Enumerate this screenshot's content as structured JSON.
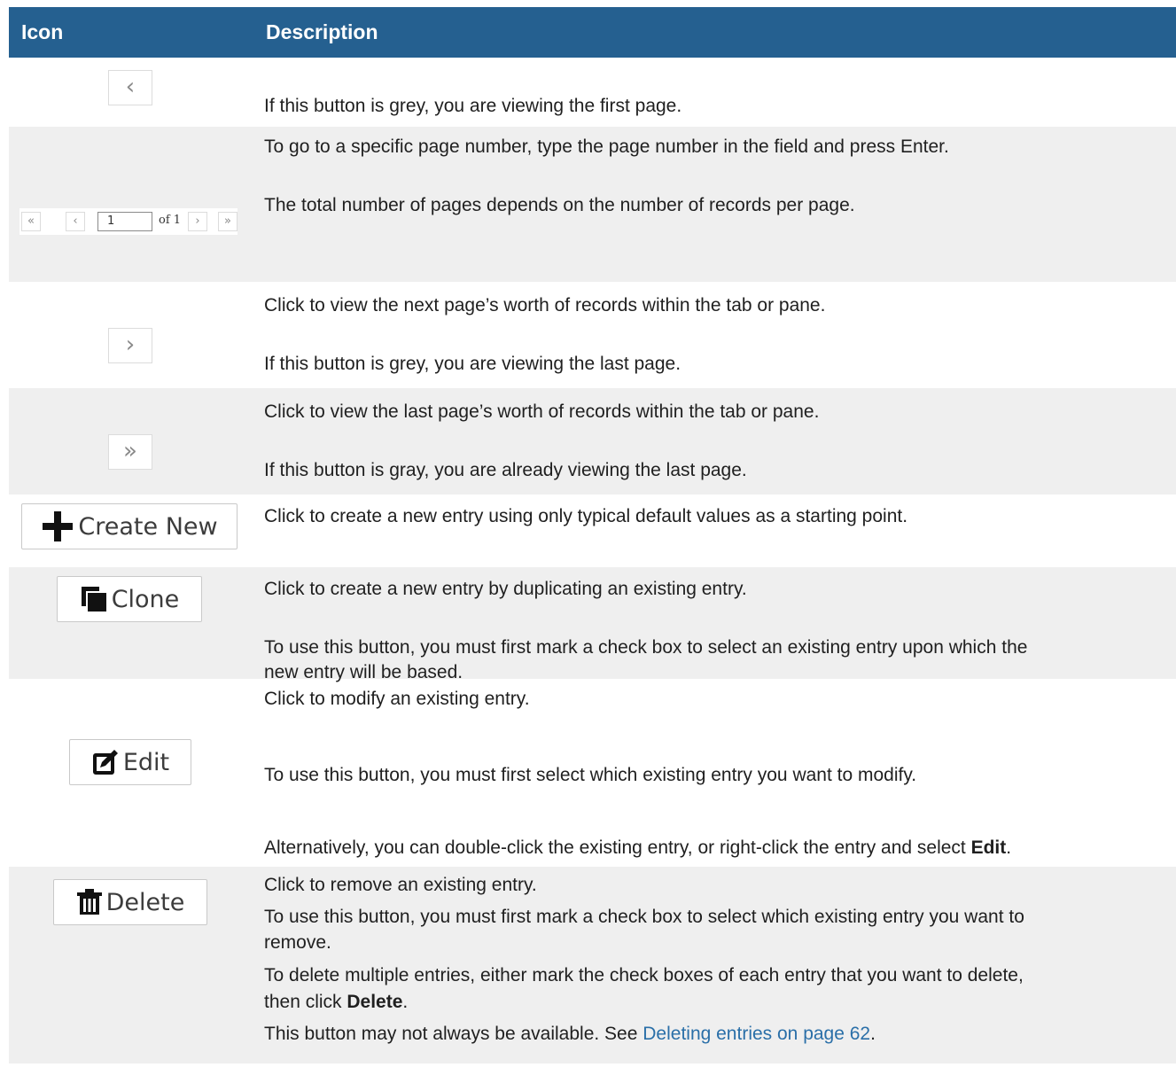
{
  "header": {
    "col_icon": "Icon",
    "col_description": "Description"
  },
  "pager": {
    "page_value": "1",
    "of_label": "of 1",
    "first": "«",
    "prev": "‹",
    "next": "›",
    "last": "»"
  },
  "buttons": {
    "prev_glyph": "‹",
    "next_glyph": "›",
    "last_glyph": "»",
    "create_new": "Create New",
    "clone": "Clone",
    "edit": "Edit",
    "delete": "Delete"
  },
  "rows": [
    {
      "p": [
        "If this button is grey, you are viewing the first page."
      ]
    },
    {
      "p": [
        "To go to a specific page number, type the page number in the field and press Enter.",
        "The total number of pages depends on the number of records per page."
      ]
    },
    {
      "p": [
        "Click to view the next page’s worth of records within the tab or pane.",
        "If this button is grey, you are viewing the last page."
      ]
    },
    {
      "p": [
        "Click to view the last page’s worth of records within the tab or pane.",
        "If this button is gray, you are already viewing the last page."
      ]
    },
    {
      "p": [
        "Click to create a new entry using only typical default values as a starting point."
      ]
    },
    {
      "p": [
        "Click to create a new entry by duplicating an existing entry.",
        "To use this button, you must first mark a check box to select an existing entry upon which the",
        "new entry will be based."
      ]
    },
    {
      "p": [
        "Click to modify an existing entry.",
        "To use this button, you must first select which existing entry you want to modify.",
        "Alternatively, you can double-click the existing entry, or right-click the entry and select ",
        "Edit",
        "."
      ]
    },
    {
      "p": [
        "Click to remove an existing entry.",
        "To use this button, you must first mark a check box to select which existing entry you want to",
        "remove.",
        "To delete multiple entries, either mark the check boxes of each entry that you want to delete,",
        "then click ",
        "Delete",
        ".",
        "This button may not always be available. See ",
        "Deleting entries on page 62",
        "."
      ]
    }
  ]
}
